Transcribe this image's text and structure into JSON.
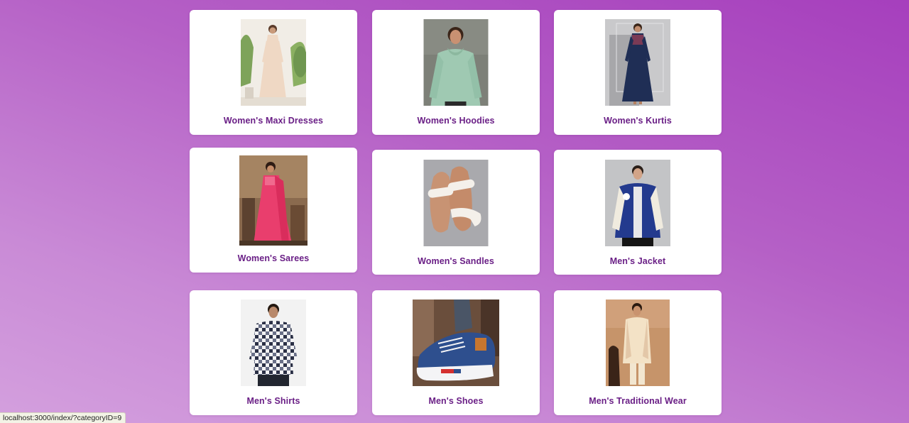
{
  "categories": [
    {
      "label": "Women's Maxi Dresses",
      "icon": "maxi-dress-photo"
    },
    {
      "label": "Women's Hoodies",
      "icon": "hoodie-photo"
    },
    {
      "label": "Women's Kurtis",
      "icon": "kurti-photo"
    },
    {
      "label": "Women's Sarees",
      "icon": "saree-photo"
    },
    {
      "label": "Women's Sandles",
      "icon": "sandal-photo"
    },
    {
      "label": "Men's Jacket",
      "icon": "jacket-photo"
    },
    {
      "label": "Men's Shirts",
      "icon": "shirt-photo"
    },
    {
      "label": "Men's Shoes",
      "icon": "shoes-photo"
    },
    {
      "label": "Men's Traditional Wear",
      "icon": "traditional-wear-photo"
    }
  ],
  "status_bar": {
    "url": "localhost:3000/index/?categoryID=9"
  },
  "colors": {
    "accent_text": "#6a1f86",
    "background_top": "#a63fbd",
    "background_bottom": "#d4a0de"
  }
}
